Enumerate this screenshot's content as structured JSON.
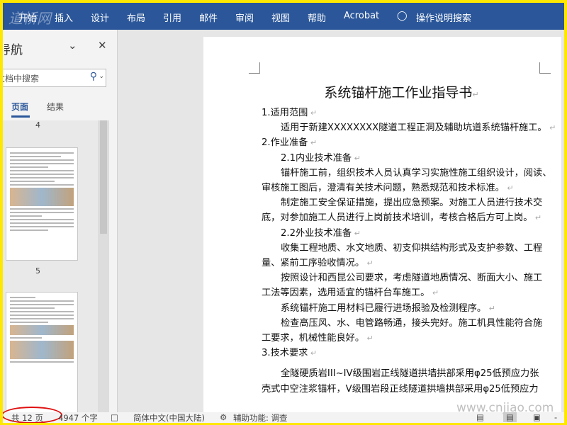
{
  "ribbon": {
    "tabs": [
      "开始",
      "插入",
      "设计",
      "布局",
      "引用",
      "邮件",
      "审阅",
      "视图",
      "帮助",
      "Acrobat"
    ],
    "tell_me": "操作说明搜索",
    "watermark": "道桥网"
  },
  "nav": {
    "title": "导航",
    "search_placeholder": "在文档中搜索",
    "tabs": {
      "pages": "页面",
      "results": "结果"
    },
    "page_numbers": [
      "4",
      "5"
    ]
  },
  "document": {
    "title": "系统锚杆施工作业指导书",
    "lines": [
      {
        "t": "1.适用范围",
        "i": false
      },
      {
        "t": "适用于新建XXXXXXXX隧道工程正洞及辅助坑道系统锚杆施工。",
        "i": true
      },
      {
        "t": "2.作业准备",
        "i": false
      },
      {
        "t": "2.1内业技术准备",
        "i": true
      },
      {
        "t": "锚杆施工前，组织技术人员认真学习实施性施工组织设计，阅读、",
        "i": true,
        "nopm": true
      },
      {
        "t": "审核施工图后，澄清有关技术问题，熟悉规范和技术标准。",
        "i": false
      },
      {
        "t": "制定施工安全保证措施，提出应急预案。对施工人员进行技术交",
        "i": true,
        "nopm": true
      },
      {
        "t": "底，对参加施工人员进行上岗前技术培训，考核合格后方可上岗。",
        "i": false
      },
      {
        "t": "2.2外业技术准备",
        "i": true
      },
      {
        "t": "收集工程地质、水文地质、初支仰拱结构形式及支护参数、工程",
        "i": true,
        "nopm": true
      },
      {
        "t": "量、紧前工序验收情况。",
        "i": false
      },
      {
        "t": "按照设计和西昆公司要求，考虑隧道地质情况、断面大小、施工",
        "i": true,
        "nopm": true
      },
      {
        "t": "工法等因素，选用适宜的锚杆台车施工。",
        "i": false
      },
      {
        "t": "系统锚杆施工用材料已履行进场报验及检测程序。",
        "i": true
      },
      {
        "t": "检查高压风、水、电管路畅通，接头完好。施工机具性能符合施",
        "i": true,
        "nopm": true
      },
      {
        "t": "工要求，机械性能良好。",
        "i": false
      },
      {
        "t": "3.技术要求",
        "i": false
      },
      {
        "t": "全隧硬质岩III~IV级围岩正线隧道拱墙拱部采用φ25低预应力张",
        "i": true,
        "nopm": true,
        "gap": true
      },
      {
        "t": "壳式中空注浆锚杆，V级围岩段正线隧道拱墙拱部采用φ25低预应力",
        "i": false,
        "nopm": true
      }
    ]
  },
  "status": {
    "pages": "共 12 页",
    "words": "4947 个字",
    "language": "简体中文(中国大陆)",
    "accessibility": "辅助功能: 调查",
    "watermark": "www.cnjiao.com"
  },
  "colors": {
    "ribbon": "#2b579a",
    "frame": "#ffe800",
    "annotation": "#e01010"
  }
}
